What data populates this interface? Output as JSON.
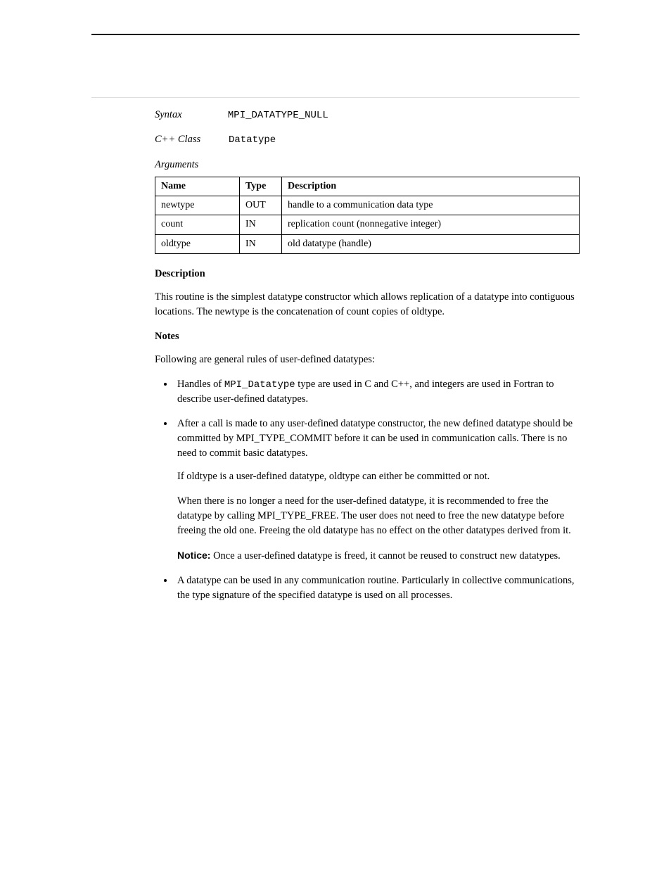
{
  "intro": {
    "syntax_label": "Syntax",
    "syntax_code": "MPI_DATATYPE_NULL",
    "class_label": "C++ Class",
    "class_code": "Datatype",
    "arguments_label": "Arguments"
  },
  "args_table": {
    "headers": [
      "Name",
      "Type",
      "Description"
    ],
    "rows": [
      [
        "newtype",
        "OUT",
        "handle to a communication data type"
      ],
      [
        "count",
        "IN",
        "replication count (nonnegative integer)"
      ],
      [
        "oldtype",
        "IN",
        "old datatype (handle)"
      ]
    ]
  },
  "description_heading": "Description",
  "description_text": "This routine is the simplest datatype constructor which allows replication of a datatype into contiguous locations. The newtype is the concatenation of count copies of oldtype.",
  "notes_heading": "Notes",
  "notes_intro": "Following are general rules of user-defined datatypes:",
  "bullets": [
    {
      "prefix": "Handles of ",
      "code": "MPI_Datatype",
      "suffix": " type are used in C and C++, and integers are used in Fortran to describe user-defined datatypes."
    },
    {
      "text": "After a call is made to any user-defined datatype constructor, the new defined datatype should be committed by ",
      "link": "MPI_TYPE_COMMIT",
      "text2": " before it can be used in communication calls. There is no need to commit basic datatypes."
    }
  ],
  "continue_1": "If oldtype is a user-defined datatype, oldtype can either be committed or not.",
  "continue_2": {
    "text1": "When there is no longer a need for the user-defined datatype, it is recommended to free the datatype by calling ",
    "link": "MPI_TYPE_FREE",
    "text2": ". The user does not need to free the new datatype before freeing the old one. Freeing the old datatype has no effect on the other datatypes derived from it."
  },
  "notice": {
    "label": "Notice:",
    "text": " Once a user-defined datatype is freed, it cannot be reused to construct new datatypes."
  },
  "bullet_last": "A datatype can be used in any communication routine. Particularly in collective communications, the type signature of the specified datatype is used on all processes."
}
